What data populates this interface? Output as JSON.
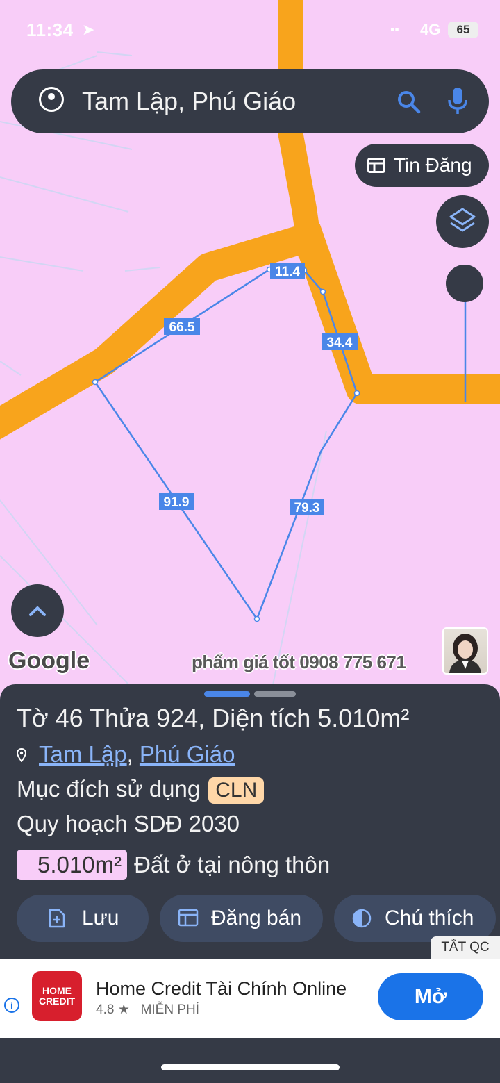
{
  "status_bar": {
    "time": "11:34",
    "location_icon": "location-arrow-icon",
    "network": "4G",
    "battery": "65"
  },
  "search": {
    "query": "Tam Lập, Phú Giáo",
    "account_icon": "account-icon",
    "search_icon": "search-icon",
    "mic_icon": "mic-icon"
  },
  "map": {
    "tin_dang_label": "Tin Đăng",
    "plot_edges": [
      "11.4",
      "66.5",
      "34.4",
      "91.9",
      "79.3"
    ],
    "google_label": "Google",
    "watermark": "phẩm giá tốt 0908 775 671",
    "colors": {
      "land": "#f8cdf8",
      "road": "#f8a41c",
      "boundary": "#4a86e8"
    }
  },
  "sheet": {
    "title": "Tờ 46 Thửa 924, Diện tích 5.010m²",
    "location_part1": "Tam Lập",
    "separator": ", ",
    "location_part2": "Phú Giáo",
    "purpose_label": "Mục đích sử dụng",
    "purpose_code": "CLN",
    "plan_label": "Quy hoạch SDĐ 2030",
    "area_value": "5.010m²",
    "area_type": "Đất ở tại nông thôn",
    "actions": {
      "save": "Lưu",
      "post": "Đăng bán",
      "legend": "Chú thích"
    }
  },
  "ad": {
    "hide_label": "TẮT QC",
    "logo_text_1": "HOME",
    "logo_text_2": "CREDIT",
    "app_name": "Home Credit Tài Chính Online",
    "rating": "4.8 ★",
    "price": "MIỄN PHÍ",
    "open_label": "Mở"
  }
}
